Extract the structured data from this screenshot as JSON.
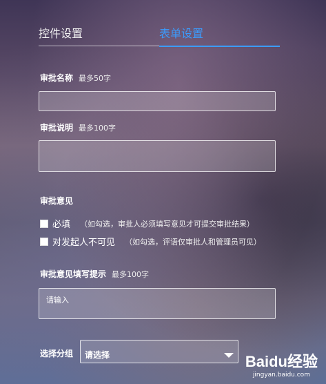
{
  "tabs": [
    {
      "label": "控件设置"
    },
    {
      "label": "表单设置"
    }
  ],
  "approval_name": {
    "label": "审批名称",
    "hint": "最多50字",
    "value": ""
  },
  "approval_desc": {
    "label": "审批说明",
    "hint": "最多100字",
    "value": ""
  },
  "approval_opinion": {
    "label": "审批意见",
    "options": [
      {
        "label": "必填",
        "note": "（如勾选，审批人必须填写意见才可提交审批结果）"
      },
      {
        "label": "对发起人不可见",
        "note": "（如勾选，评语仅审批人和管理员可见）"
      }
    ]
  },
  "opinion_prompt": {
    "label": "审批意见填写提示",
    "hint": "最多100字",
    "placeholder": "请输入"
  },
  "group": {
    "label": "选择分组",
    "selected": "请选择"
  },
  "watermark": {
    "brand": "Baidu经验",
    "url": "jingyan.baidu.com"
  },
  "colors": {
    "accent": "#3b9cff"
  }
}
